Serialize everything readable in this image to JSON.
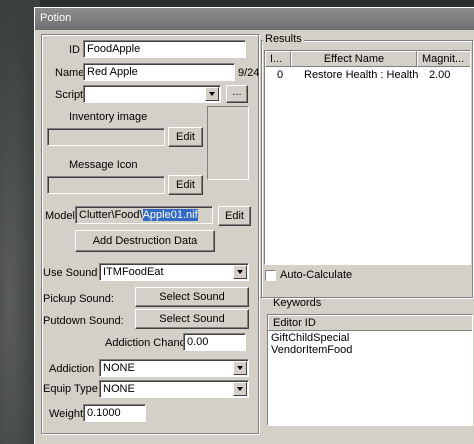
{
  "window": {
    "title": "Potion"
  },
  "form": {
    "id_label": "ID",
    "id_value": "FoodApple",
    "name_label": "Name",
    "name_value": "Red Apple",
    "name_count": "9/24",
    "script_label": "Script",
    "script_value": "",
    "script_browse": "...",
    "inventory_image_label": "Inventory image",
    "inventory_edit": "Edit",
    "message_icon_label": "Message Icon",
    "message_edit": "Edit",
    "model_label": "Model",
    "model_path_prefix": "Clutter\\Food\\",
    "model_path_selected": "Apple01.nif",
    "model_edit": "Edit",
    "add_destruction": "Add Destruction Data",
    "use_sound_label": "Use Sound",
    "use_sound_value": "ITMFoodEat",
    "pickup_sound_label": "Pickup Sound:",
    "pickup_sound_button": "Select Sound",
    "putdown_sound_label": "Putdown Sound:",
    "putdown_sound_button": "Select Sound",
    "addiction_chance_label": "Addiction Chance",
    "addiction_chance_value": "0.00",
    "addiction_label": "Addiction",
    "addiction_value": "NONE",
    "equip_type_label": "Equip Type",
    "equip_type_value": "NONE",
    "weight_label": "Weight",
    "weight_value": "0.1000"
  },
  "results": {
    "title": "Results",
    "columns": [
      "I...",
      "Effect Name",
      "Magnit..."
    ],
    "rows": [
      {
        "index": "0",
        "effect": "Restore Health : Health",
        "magnitude": "2.00"
      }
    ],
    "auto_calculate_label": "Auto-Calculate",
    "auto_calculate_checked": false
  },
  "keywords": {
    "title": "Keywords",
    "column": "Editor ID",
    "items": [
      "GiftChildSpecial",
      "VendorItemFood"
    ]
  }
}
